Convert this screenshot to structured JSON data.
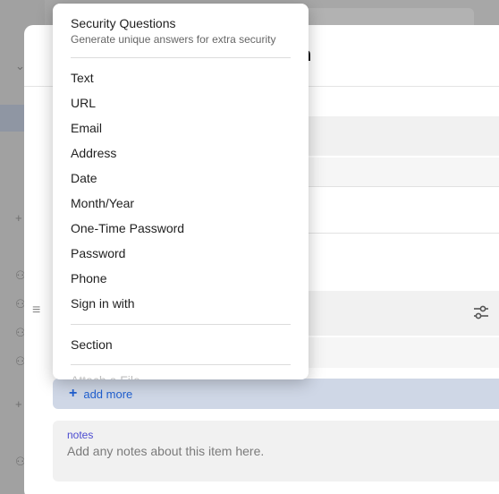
{
  "modal": {
    "title_fragment": "em"
  },
  "menu": {
    "header_title": "Security Questions",
    "header_subtitle": "Generate unique answers for extra security",
    "items": [
      {
        "label": "Text"
      },
      {
        "label": "URL"
      },
      {
        "label": "Email"
      },
      {
        "label": "Address"
      },
      {
        "label": "Date"
      },
      {
        "label": "Month/Year"
      },
      {
        "label": "One-Time Password"
      },
      {
        "label": "Password"
      },
      {
        "label": "Phone"
      },
      {
        "label": "Sign in with"
      }
    ],
    "section_label": "Section",
    "cut_label": "Attach a File"
  },
  "add_more": {
    "label": "add more",
    "icon": "plus-icon"
  },
  "notes": {
    "label": "notes",
    "placeholder": "Add any notes about this item here."
  },
  "colors": {
    "accent": "#1f5fd0",
    "notes_label": "#4b4bd0",
    "add_more_bg": "#cfd7e6"
  }
}
